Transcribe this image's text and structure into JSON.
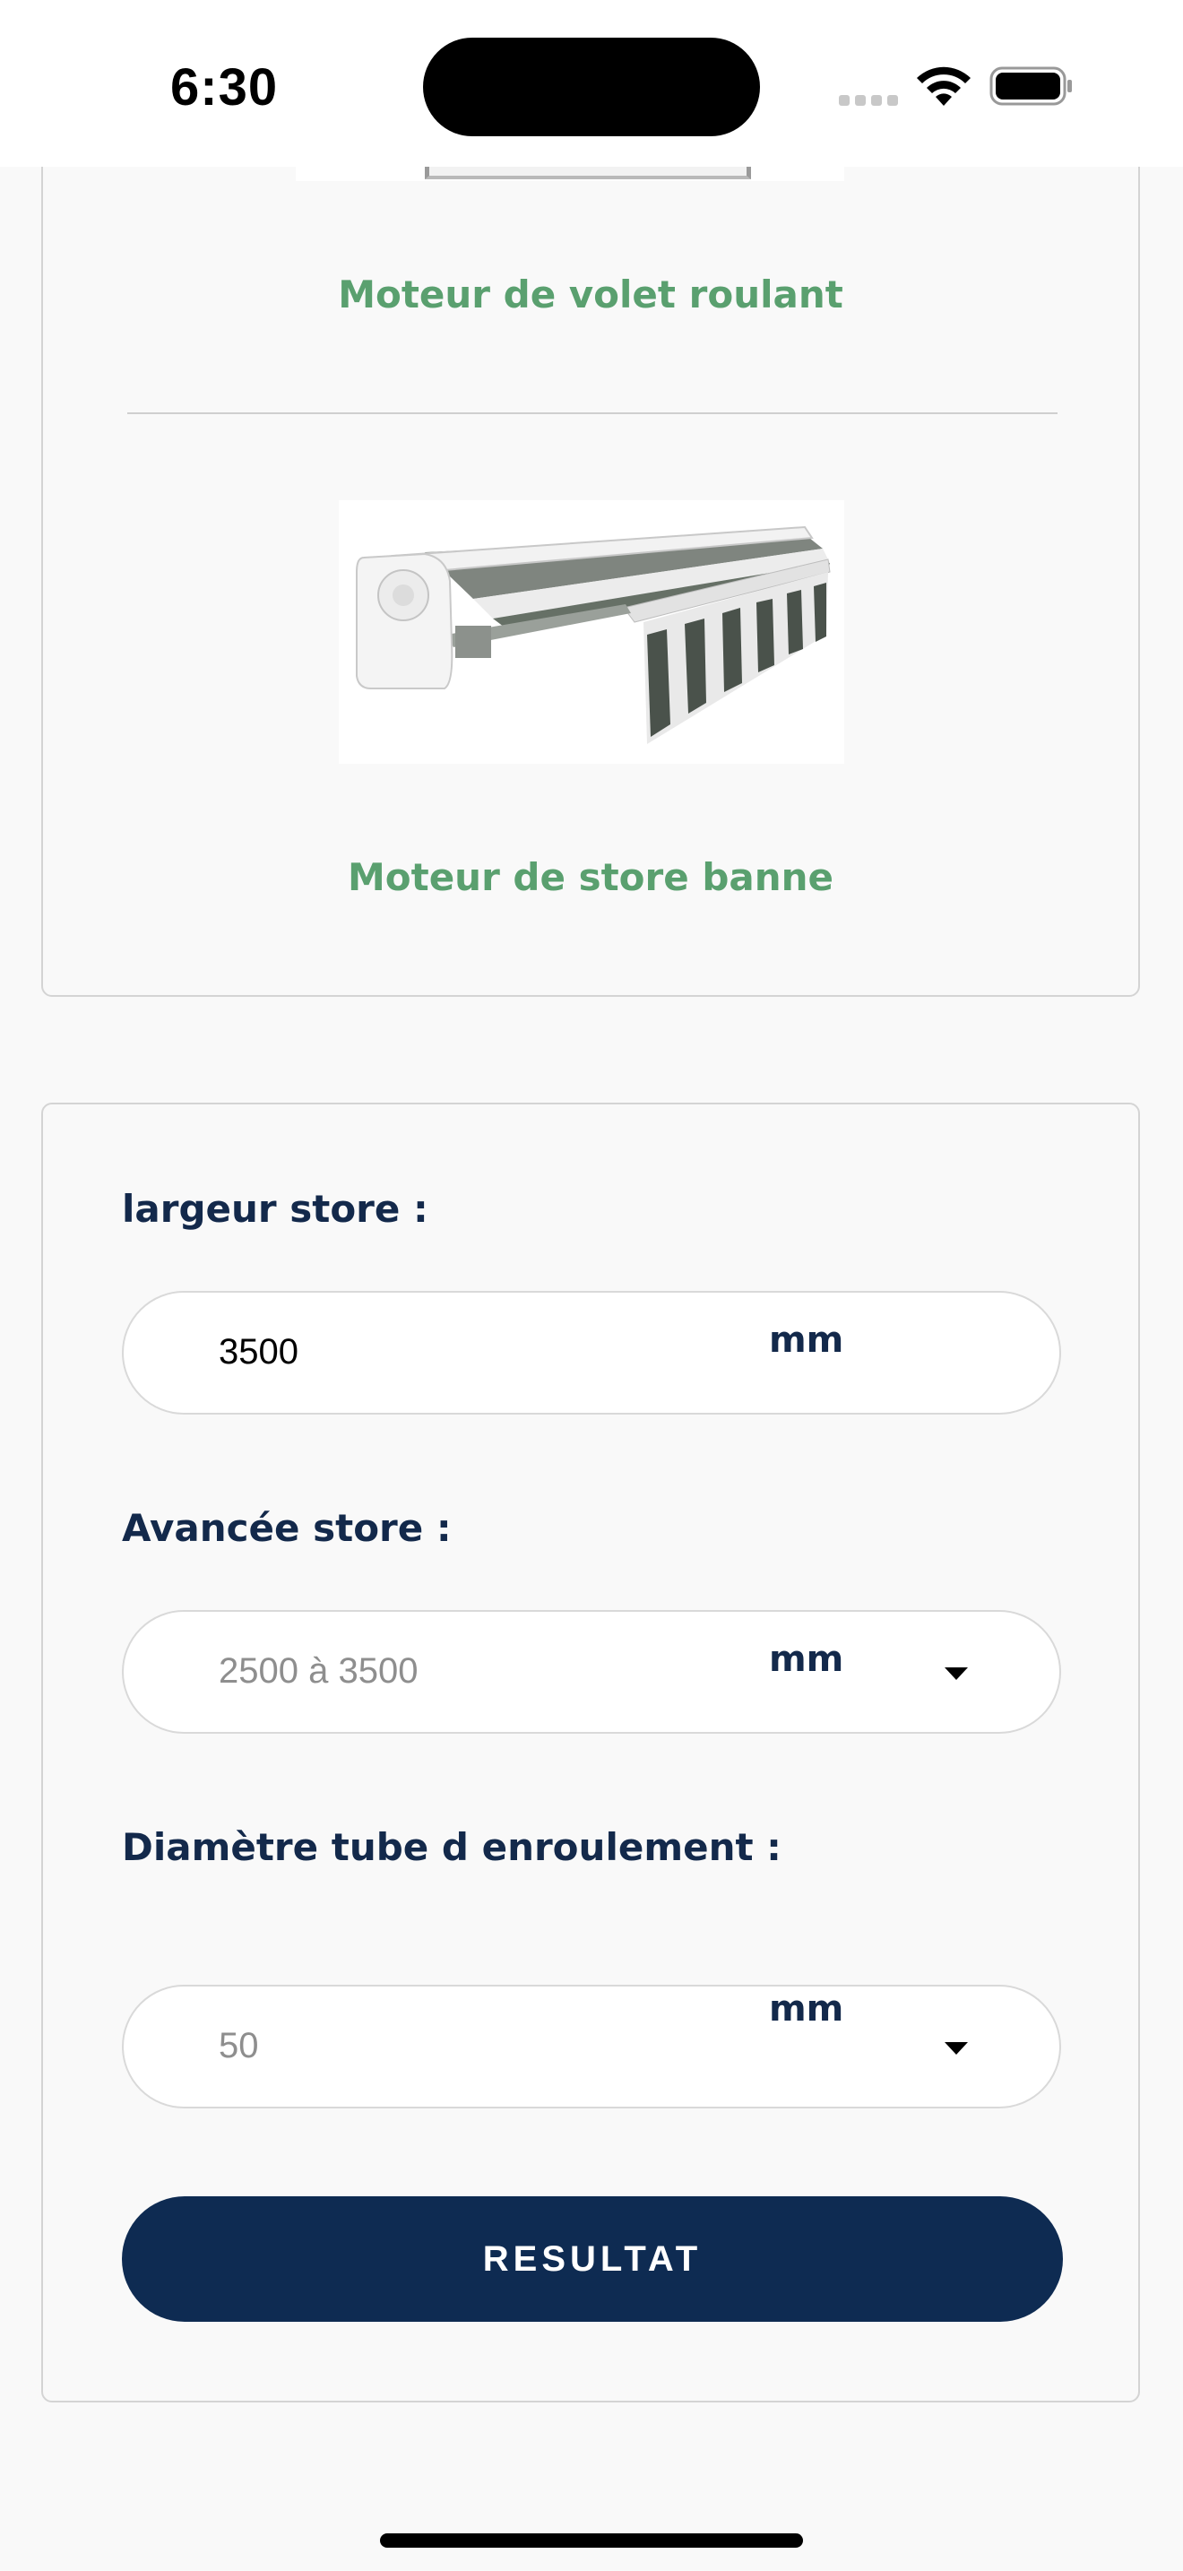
{
  "status_bar": {
    "time": "6:30"
  },
  "motor_options": {
    "shutter_label": "Moteur de volet roulant",
    "awning_label": "Moteur de store banne"
  },
  "form": {
    "width_label": "largeur store :",
    "width_value": "3500",
    "width_unit": "mm",
    "projection_label": "Avancée store :",
    "projection_placeholder": "2500 à 3500",
    "projection_unit": "mm",
    "tube_label": "Diamètre tube d enroulement :",
    "tube_placeholder": "50",
    "tube_unit": "mm",
    "submit_label": "RESULTAT"
  },
  "colors": {
    "accent_green": "#5aa06f",
    "navy": "#0e2b52",
    "label_navy": "#13294b"
  },
  "icons": [
    "signal-icon",
    "wifi-icon",
    "battery-icon",
    "chevron-down-icon"
  ]
}
